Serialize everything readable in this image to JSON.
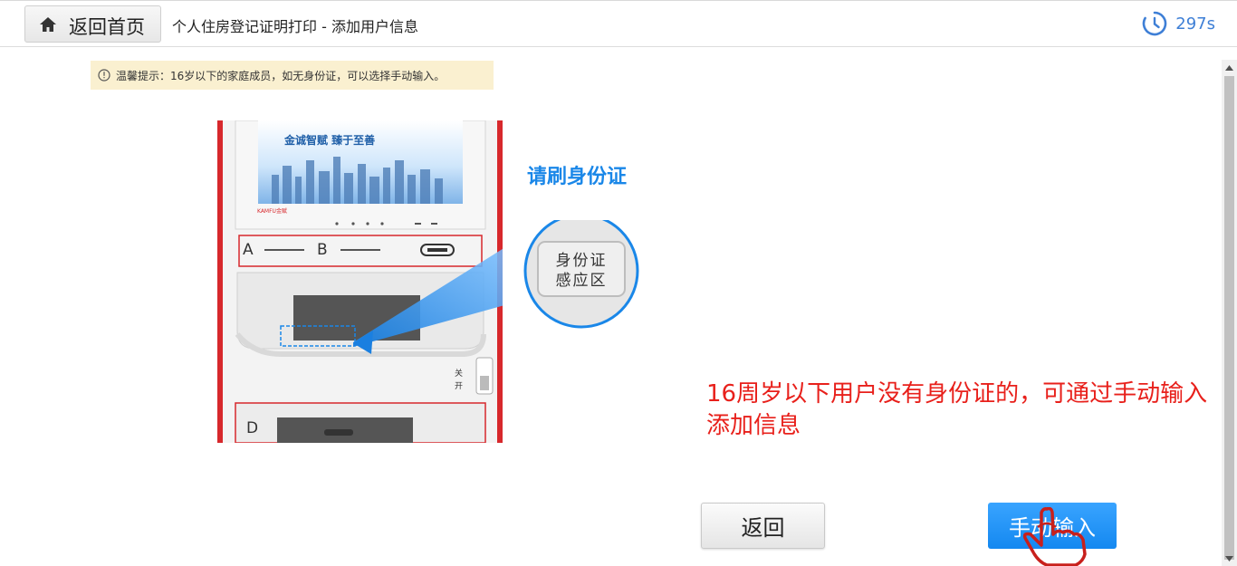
{
  "header": {
    "home_label": "返回首页",
    "breadcrumb": "个人住房登记证明打印  -  添加用户信息",
    "countdown": "297s"
  },
  "tip": {
    "text": "温馨提示：16岁以下的家庭成员，如无身份证，可以选择手动输入。"
  },
  "illustration": {
    "screen_slogan": "金诚智赋 臻于至善",
    "brand": "KAMFU金赋",
    "port_a": "A",
    "port_b": "B",
    "port_d": "D",
    "card_label_1": "身份证",
    "card_label_2": "感应区",
    "switch_off": "关",
    "switch_on": "开"
  },
  "swipe_title": "请刷身份证",
  "notice": "16周岁以下用户没有身份证的，可通过手动输入添加信息",
  "buttons": {
    "back": "返回",
    "manual": "手动输入"
  },
  "colors": {
    "accent_blue": "#1488f0",
    "notice_red": "#e8201b",
    "tip_bg": "#faf0d0"
  }
}
